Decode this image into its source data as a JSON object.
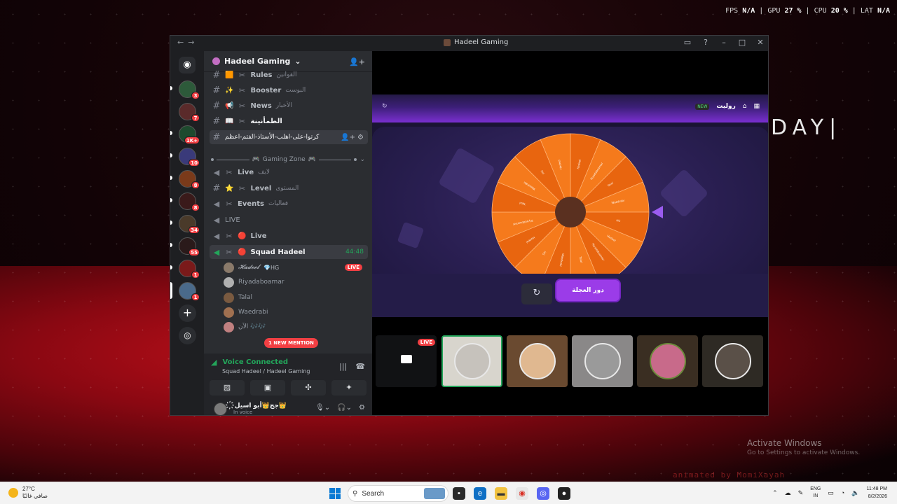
{
  "overlay": {
    "fps_label": "FPS",
    "fps": "N/A",
    "gpu_label": "GPU",
    "gpu": "27 %",
    "cpu_label": "CPU",
    "cpu": "20 %",
    "lat_label": "LAT",
    "lat": "N/A"
  },
  "wallpaper": {
    "text": "DAY|",
    "activate_title": "Activate Windows",
    "activate_sub": "Go to Settings to activate Windows.",
    "animated": "animated by MomiXayah"
  },
  "window": {
    "title": "Hadeel Gaming",
    "back": "←",
    "forward": "→"
  },
  "rail": {
    "badges": [
      "3",
      "7",
      "1K+",
      "10",
      "8",
      "8",
      "34",
      "55",
      "1",
      "1"
    ]
  },
  "server": {
    "name": "Hadeel Gaming",
    "chevron": "⌄"
  },
  "channels": [
    {
      "icon": "#",
      "emoji": "🟧",
      "name": "Rules",
      "ar": "القوانين"
    },
    {
      "icon": "#",
      "emoji": "✨",
      "name": "Booster",
      "ar": "البوست"
    },
    {
      "icon": "#",
      "emoji": "📢",
      "name": "News",
      "ar": "الأخبار"
    },
    {
      "icon": "#",
      "emoji": "📖",
      "name": "",
      "ar": "الطمأنينة"
    },
    {
      "icon": "#",
      "emoji": "",
      "name": "كرتوا-على-اهلب-الأستاذ-الفتم-اعظم",
      "ar": ""
    },
    {
      "category": "Gaming Zone"
    },
    {
      "icon": "🔊",
      "emoji": "",
      "name": "Live",
      "ar": "لايف"
    },
    {
      "icon": "#",
      "emoji": "⭐",
      "name": "Level",
      "ar": "المستوى"
    },
    {
      "icon": "🔊",
      "emoji": "",
      "name": "Events",
      "ar": "فعاليات"
    },
    {
      "icon": "🔊",
      "emoji": "",
      "name": "LIVE",
      "ar": ""
    },
    {
      "icon": "🔊",
      "emoji": "🔴",
      "name": "Live",
      "ar": ""
    },
    {
      "icon": "🔊",
      "emoji": "🔴",
      "name": "Squad Hadeel",
      "ar": "",
      "time": "44:48"
    }
  ],
  "voice_users": [
    {
      "name": "𝓗𝓪𝓭𝓮𝓮𝓵",
      "tag": "💎HG",
      "live": "LIVE"
    },
    {
      "name": "Riyadaboamar"
    },
    {
      "name": "Talal"
    },
    {
      "name": "Waedrabi"
    },
    {
      "name": "الآن 🎶🎶"
    }
  ],
  "mention": "1 NEW MENTION",
  "voice_panel": {
    "status": "Voice Connected",
    "channel": "Squad Hadeel / Hadeel Gaming"
  },
  "me": {
    "name": "҉جج👑أبو اسيل👑",
    "status": "In voice"
  },
  "activity": {
    "title": "روليت",
    "tag": "NEW",
    "spin": "دور العجلة",
    "reset": "↻"
  },
  "wheel": {
    "segments": [
      "Hadeel",
      "Riyadaboamar",
      "Talal",
      "Waedrabi",
      "HG",
      "Hadeel",
      "Riyadaboamar",
      "Talal",
      "Waedrabi",
      "HG",
      "Hadeel",
      "Riyadaboamar",
      "Talal",
      "Waedrabi",
      "HG",
      "Hadeel"
    ],
    "color_a": "#f57a1c",
    "color_b": "#e8650f",
    "hub": "#5a3020",
    "pointer": "#9b5cf0"
  },
  "tiles": [
    {
      "live": "LIVE"
    },
    {},
    {},
    {},
    {},
    {}
  ],
  "taskbar": {
    "temp": "27°C",
    "weather": "صافي غالبًا",
    "search": "Search",
    "lang1": "ENG",
    "lang2": "IN",
    "time": "11:48 PM",
    "date": "8/2/2026"
  }
}
